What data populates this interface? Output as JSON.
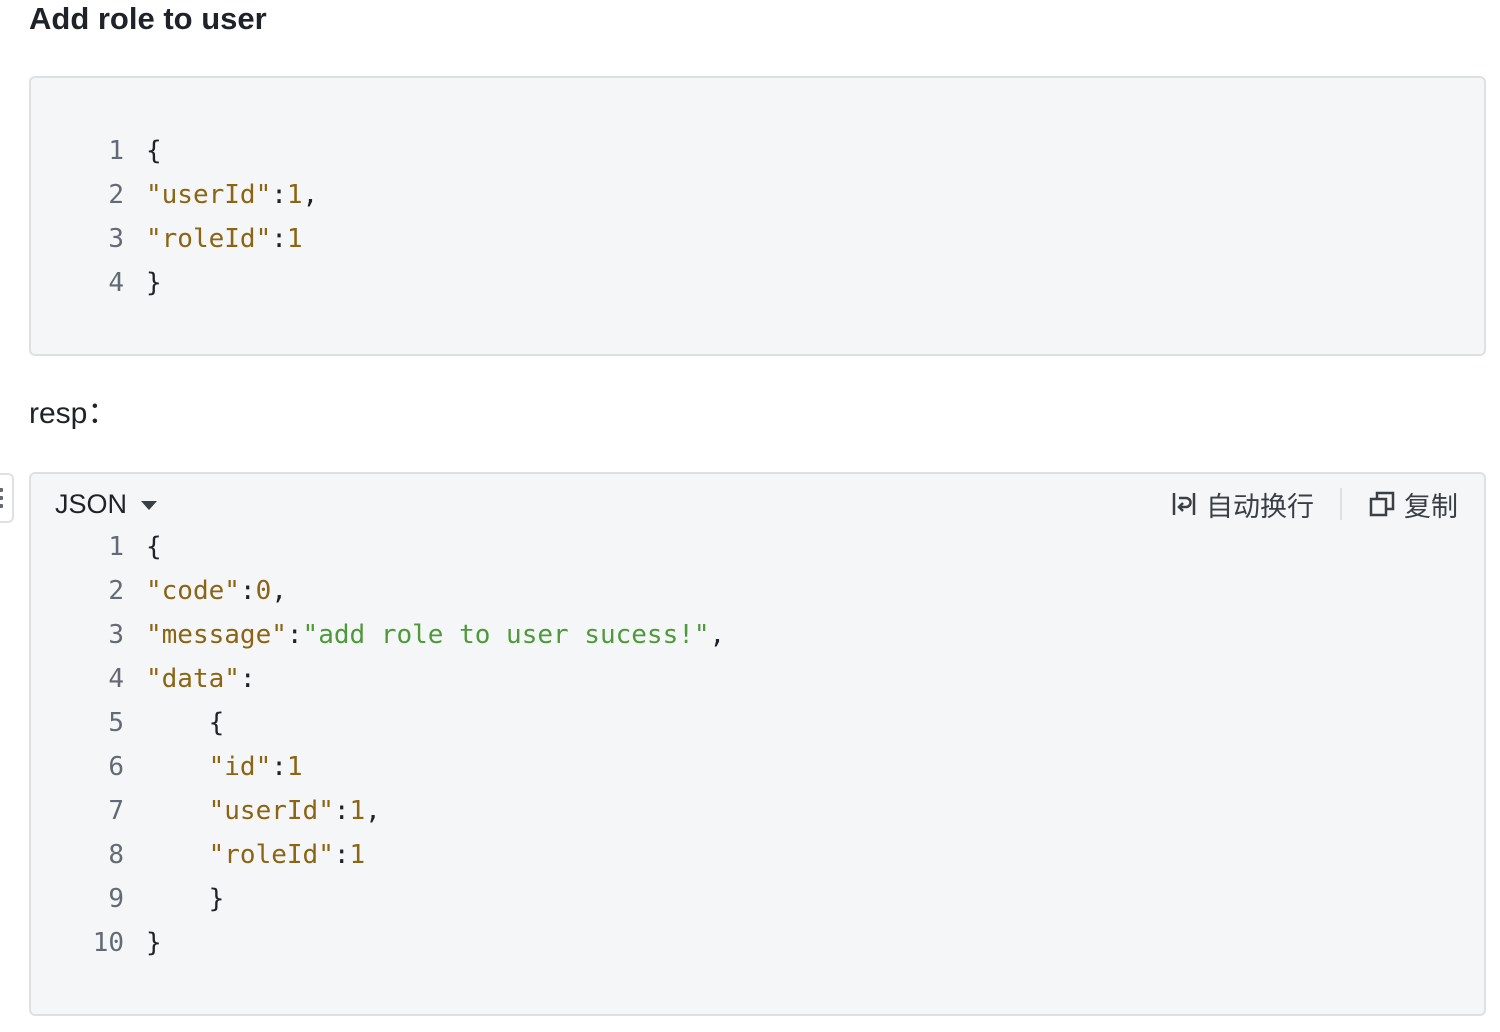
{
  "heading": "Add role to user",
  "request_block": {
    "lines": [
      {
        "num": "1",
        "tokens": [
          {
            "t": "p",
            "v": "{"
          }
        ]
      },
      {
        "num": "2",
        "tokens": [
          {
            "t": "k",
            "v": "\"userId\""
          },
          {
            "t": "p",
            "v": ":"
          },
          {
            "t": "n",
            "v": "1"
          },
          {
            "t": "p",
            "v": ","
          }
        ]
      },
      {
        "num": "3",
        "tokens": [
          {
            "t": "k",
            "v": "\"roleId\""
          },
          {
            "t": "p",
            "v": ":"
          },
          {
            "t": "n",
            "v": "1"
          }
        ]
      },
      {
        "num": "4",
        "tokens": [
          {
            "t": "p",
            "v": "}"
          }
        ]
      }
    ]
  },
  "resp_label": "resp：",
  "response_block": {
    "language": "JSON",
    "wrap_label": "自动换行",
    "copy_label": "复制",
    "lines": [
      {
        "num": "1",
        "tokens": [
          {
            "t": "p",
            "v": "{"
          }
        ]
      },
      {
        "num": "2",
        "tokens": [
          {
            "t": "k",
            "v": "\"code\""
          },
          {
            "t": "p",
            "v": ":"
          },
          {
            "t": "n",
            "v": "0"
          },
          {
            "t": "p",
            "v": ","
          }
        ]
      },
      {
        "num": "3",
        "tokens": [
          {
            "t": "k",
            "v": "\"message\""
          },
          {
            "t": "p",
            "v": ":"
          },
          {
            "t": "s",
            "v": "\"add role to user sucess!\""
          },
          {
            "t": "p",
            "v": ","
          }
        ]
      },
      {
        "num": "4",
        "tokens": [
          {
            "t": "k",
            "v": "\"data\""
          },
          {
            "t": "p",
            "v": ":"
          }
        ]
      },
      {
        "num": "5",
        "tokens": [
          {
            "t": "p",
            "v": "    {"
          }
        ]
      },
      {
        "num": "6",
        "tokens": [
          {
            "t": "p",
            "v": "    "
          },
          {
            "t": "k",
            "v": "\"id\""
          },
          {
            "t": "p",
            "v": ":"
          },
          {
            "t": "n",
            "v": "1"
          }
        ]
      },
      {
        "num": "7",
        "tokens": [
          {
            "t": "p",
            "v": "    "
          },
          {
            "t": "k",
            "v": "\"userId\""
          },
          {
            "t": "p",
            "v": ":"
          },
          {
            "t": "n",
            "v": "1"
          },
          {
            "t": "p",
            "v": ","
          }
        ]
      },
      {
        "num": "8",
        "tokens": [
          {
            "t": "p",
            "v": "    "
          },
          {
            "t": "k",
            "v": "\"roleId\""
          },
          {
            "t": "p",
            "v": ":"
          },
          {
            "t": "n",
            "v": "1"
          }
        ]
      },
      {
        "num": "9",
        "tokens": [
          {
            "t": "p",
            "v": "    }"
          }
        ]
      },
      {
        "num": "10",
        "tokens": [
          {
            "t": "p",
            "v": "}"
          }
        ]
      }
    ]
  },
  "colors": {
    "key": "#8b6414",
    "number": "#8b6414",
    "string": "#4e9a3a",
    "code_bg": "#f5f6f7",
    "border": "#dee0e3"
  },
  "icons": {
    "wrap": "wrap-icon",
    "copy": "copy-icon",
    "caret": "caret-down-icon",
    "handle": "drag-handle-icon"
  }
}
